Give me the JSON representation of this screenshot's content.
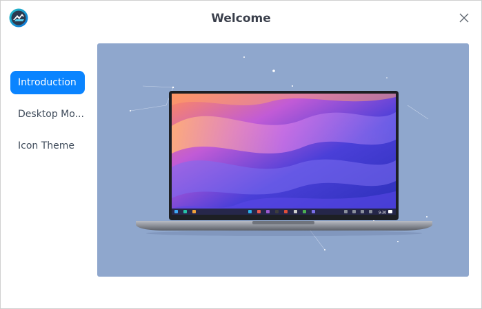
{
  "window": {
    "title": "Welcome",
    "app_icon": "deepin-logo-icon",
    "close_icon": "close-icon"
  },
  "sidebar": {
    "items": [
      {
        "label": "Introduction",
        "active": true
      },
      {
        "label": "Desktop Mo...",
        "active": false
      },
      {
        "label": "Icon Theme",
        "active": false
      }
    ]
  },
  "preview": {
    "image": "laptop-with-wallpaper-illustration",
    "taskbar_clock": "9:30"
  },
  "colors": {
    "accent": "#0a84ff",
    "preview_background": "#8fa7cd",
    "title_text": "#3a3f4b"
  }
}
